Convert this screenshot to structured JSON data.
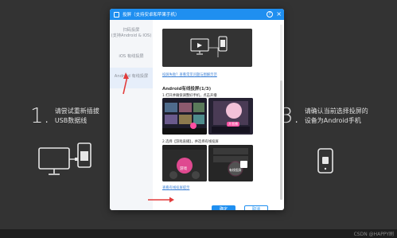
{
  "background": {
    "step1": {
      "number": "1.",
      "line1": "请尝试重新插拔",
      "line2": "USB数据线"
    },
    "step3": {
      "number": "3.",
      "line1": "请确认当前选择投屏的",
      "line2": "设备为Android手机"
    },
    "watermark": "CSDN @HAPPY刷"
  },
  "dialog": {
    "title": "投屏（支持安卓和苹果手机）",
    "help_icon": "question-icon",
    "close_icon": "close-icon",
    "sidebar": [
      {
        "line1": "扫码投屏",
        "line2": "(支持Android & IOS)"
      },
      {
        "line1": "iOS 有线投屏",
        "line2": ""
      },
      {
        "line1": "Android 有线投屏",
        "line2": ""
      }
    ],
    "content": {
      "link_top": "投屏失败？查看常见问题与图解示范",
      "section_title": "Android有线投屏(1/3)",
      "step1_text": "1.打开并确保调整好手机，点击开播",
      "step2_text": "2.选择【游戏直播】，并选择有线投屏",
      "step1_badge": "开直播",
      "step2_label_a": "游戏",
      "step2_label_b": "有线投屏",
      "link_bottom": "查看有线投屏提示"
    },
    "buttons": {
      "ok": "确定",
      "cancel": "取消"
    }
  },
  "colors": {
    "accent": "#1f8ff0",
    "annotation": "#e23b3b",
    "dark_bg": "#333333"
  }
}
